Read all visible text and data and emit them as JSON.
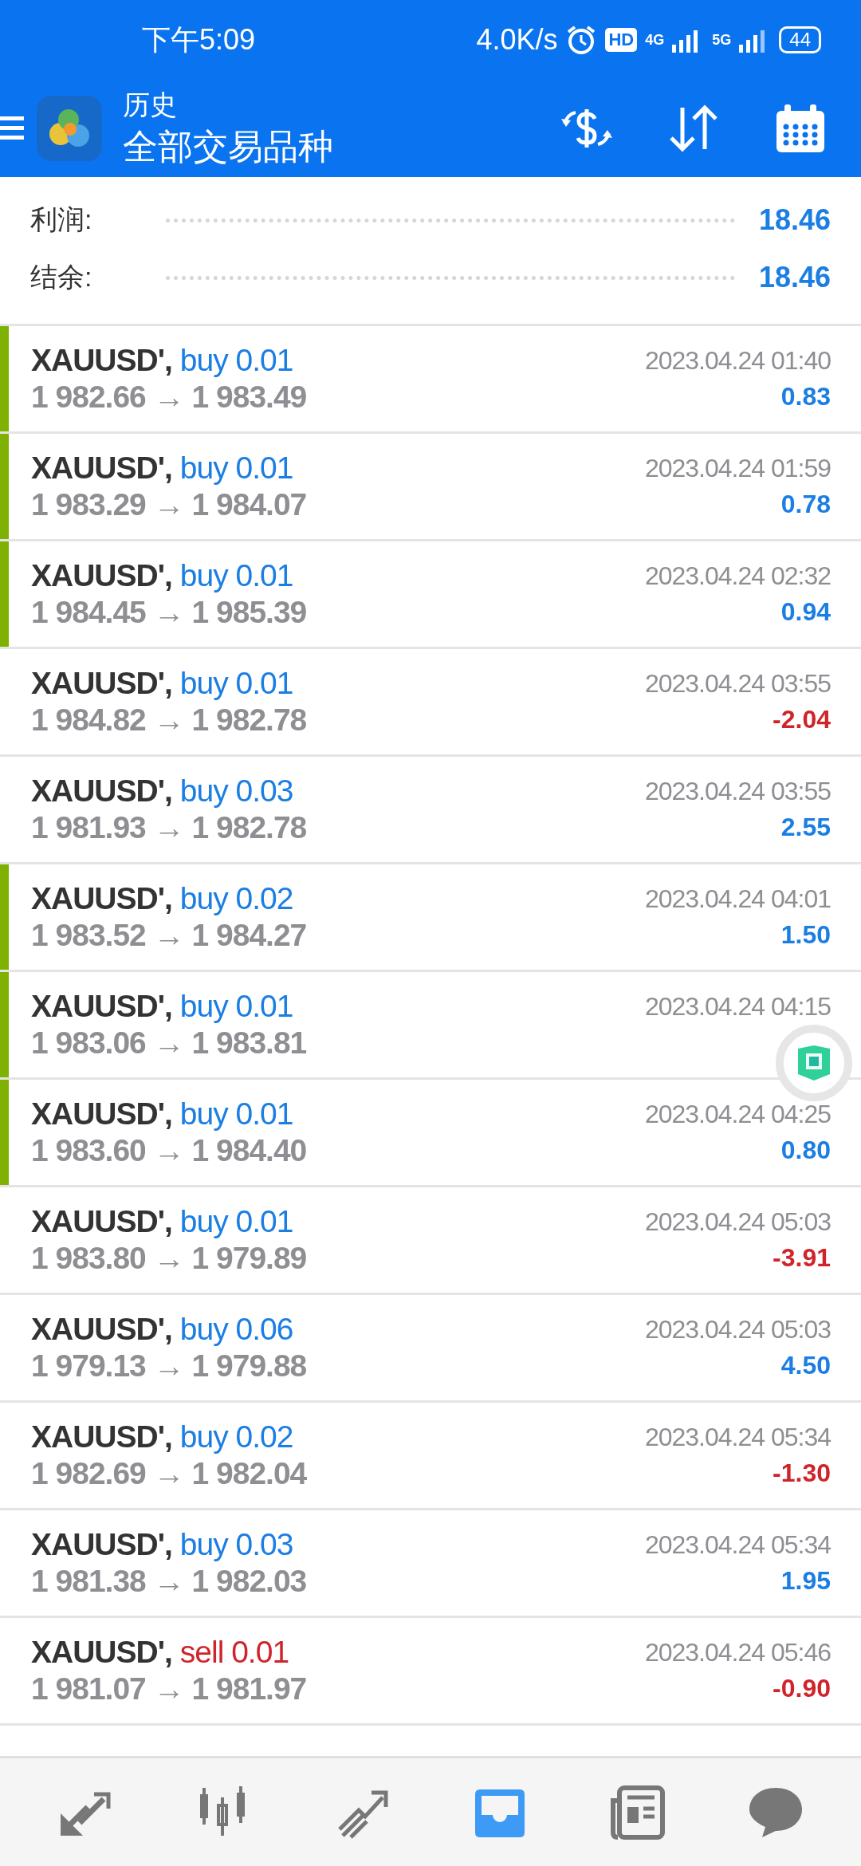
{
  "status_bar": {
    "time": "下午5:09",
    "net_speed": "4.0K/s",
    "hd": "HD",
    "sim1": "4G",
    "sim2": "5G",
    "battery": "44"
  },
  "header": {
    "title": "历史",
    "subtitle": "全部交易品种"
  },
  "summary": [
    {
      "label": "利润:",
      "value": "18.46"
    },
    {
      "label": "结余:",
      "value": "18.46"
    }
  ],
  "trades": [
    {
      "symbol": "XAUUSD',",
      "side": "buy",
      "kind": "buy",
      "volume": "0.01",
      "prices": "1 982.66 → 1 983.49",
      "time": "2023.04.24 01:40",
      "profit": "0.83",
      "negative": false,
      "marked": true
    },
    {
      "symbol": "XAUUSD',",
      "side": "buy",
      "kind": "buy",
      "volume": "0.01",
      "prices": "1 983.29 → 1 984.07",
      "time": "2023.04.24 01:59",
      "profit": "0.78",
      "negative": false,
      "marked": true
    },
    {
      "symbol": "XAUUSD',",
      "side": "buy",
      "kind": "buy",
      "volume": "0.01",
      "prices": "1 984.45 → 1 985.39",
      "time": "2023.04.24 02:32",
      "profit": "0.94",
      "negative": false,
      "marked": true
    },
    {
      "symbol": "XAUUSD',",
      "side": "buy",
      "kind": "buy",
      "volume": "0.01",
      "prices": "1 984.82 → 1 982.78",
      "time": "2023.04.24 03:55",
      "profit": "-2.04",
      "negative": true,
      "marked": false
    },
    {
      "symbol": "XAUUSD',",
      "side": "buy",
      "kind": "buy",
      "volume": "0.03",
      "prices": "1 981.93 → 1 982.78",
      "time": "2023.04.24 03:55",
      "profit": "2.55",
      "negative": false,
      "marked": false
    },
    {
      "symbol": "XAUUSD',",
      "side": "buy",
      "kind": "buy",
      "volume": "0.02",
      "prices": "1 983.52 → 1 984.27",
      "time": "2023.04.24 04:01",
      "profit": "1.50",
      "negative": false,
      "marked": true
    },
    {
      "symbol": "XAUUSD',",
      "side": "buy",
      "kind": "buy",
      "volume": "0.01",
      "prices": "1 983.06 → 1 983.81",
      "time": "2023.04.24 04:15",
      "marked": true
    },
    {
      "symbol": "XAUUSD',",
      "side": "buy",
      "kind": "buy",
      "volume": "0.01",
      "prices": "1 983.60 → 1 984.40",
      "time": "2023.04.24 04:25",
      "profit": "0.80",
      "negative": false,
      "marked": true
    },
    {
      "symbol": "XAUUSD',",
      "side": "buy",
      "kind": "buy",
      "volume": "0.01",
      "prices": "1 983.80 → 1 979.89",
      "time": "2023.04.24 05:03",
      "profit": "-3.91",
      "negative": true,
      "marked": false
    },
    {
      "symbol": "XAUUSD',",
      "side": "buy",
      "kind": "buy",
      "volume": "0.06",
      "prices": "1 979.13 → 1 979.88",
      "time": "2023.04.24 05:03",
      "profit": "4.50",
      "negative": false,
      "marked": false
    },
    {
      "symbol": "XAUUSD',",
      "side": "buy",
      "kind": "buy",
      "volume": "0.02",
      "prices": "1 982.69 → 1 982.04",
      "time": "2023.04.24 05:34",
      "profit": "-1.30",
      "negative": true,
      "marked": false
    },
    {
      "symbol": "XAUUSD',",
      "side": "buy",
      "kind": "buy",
      "volume": "0.03",
      "prices": "1 981.38 → 1 982.03",
      "time": "2023.04.24 05:34",
      "profit": "1.95",
      "negative": false,
      "marked": false
    },
    {
      "symbol": "XAUUSD',",
      "side": "sell",
      "kind": "sell",
      "volume": "0.01",
      "prices": "1 981.07 → 1 981.97",
      "time": "2023.04.24 05:46",
      "profit": "-0.90",
      "negative": true,
      "marked": false
    }
  ],
  "nav": [
    {
      "kind": "quotes",
      "selected": false
    },
    {
      "kind": "chart",
      "selected": false
    },
    {
      "kind": "trade",
      "selected": false
    },
    {
      "kind": "history",
      "selected": true
    },
    {
      "kind": "news",
      "selected": false
    },
    {
      "kind": "chat",
      "selected": false
    }
  ]
}
